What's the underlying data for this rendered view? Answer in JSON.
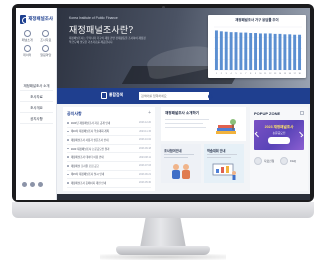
{
  "site": {
    "logo_text": "재정패널조사"
  },
  "sidebar": {
    "nav": [
      {
        "label": "패널소개",
        "icon": "info-icon"
      },
      {
        "label": "조사자료",
        "icon": "document-icon"
      },
      {
        "label": "데이터",
        "icon": "database-icon"
      },
      {
        "label": "알림마당",
        "icon": "bell-icon"
      }
    ],
    "menu": [
      "재정패널조사 소개",
      "조사자료",
      "조사개요",
      "공지사항"
    ],
    "social_icons": [
      "facebook-icon",
      "twitter-icon",
      "blog-icon"
    ]
  },
  "hero": {
    "small_text": "Korea Institute of Public Finance",
    "title": "재정패널조사란?",
    "description": "재정패널조사는 우리나라 가구의 재정 관련 경제활동을 조사하여 재정정책 연구에 필요한 기초자료를 제공합니다."
  },
  "chart_data": {
    "type": "bar",
    "title": "재정패널조사 가구 응답률 추이",
    "categories": [
      "1",
      "2",
      "3",
      "4",
      "5",
      "6",
      "7",
      "8",
      "9",
      "10",
      "11",
      "12",
      "13",
      "14",
      "15",
      "16",
      "17",
      "18"
    ],
    "values": [
      92,
      90,
      89,
      88,
      88,
      87,
      87,
      86,
      86,
      85,
      85,
      85,
      84,
      84,
      83,
      83,
      82,
      82
    ],
    "ylim": [
      0,
      100
    ],
    "grid": true,
    "legend": "none"
  },
  "search": {
    "label": "통합검색",
    "placeholder": "검색어를 입력하세요"
  },
  "news": {
    "title": "공지사항",
    "more": "+",
    "items": [
      {
        "text": "2023년 재정패널조사 자료 공개 안내",
        "date": "2023.12.20"
      },
      {
        "text": "제16차 재정패널조사 학술대회 개최",
        "date": "2023.11.15"
      },
      {
        "text": "재정패널조사 사용자 설문조사 안내",
        "date": "2023.10.02"
      },
      {
        "text": "2023 재정패널조사 논문공모전 결과",
        "date": "2023.09.18"
      },
      {
        "text": "재정패널조사 데이터 이용 안내",
        "date": "2023.08.11"
      },
      {
        "text": "재정패널 조사원 모집 공고",
        "date": "2023.07.03"
      },
      {
        "text": "제15차 재정패널조사 실시 안내",
        "date": "2023.06.21"
      },
      {
        "text": "재정패널조사 홈페이지 개편 안내",
        "date": "2023.05.30"
      }
    ]
  },
  "intro": {
    "title": "재정패널조사 소개하기"
  },
  "cards": [
    {
      "title": "조사참여안내"
    },
    {
      "title": "학술대회 안내"
    }
  ],
  "popup": {
    "title": "POPUP ZONE",
    "banner_head": "2023 재정패널조사",
    "banner_sub": "논문공모전"
  },
  "quick_links": [
    {
      "label": "자료신청",
      "icon": "download-icon"
    },
    {
      "label": "FAQ",
      "icon": "question-icon"
    }
  ],
  "colors": {
    "primary": "#1f3f8f",
    "chart_bar": "#5b8fd1",
    "banner": "#6b4bbf"
  }
}
